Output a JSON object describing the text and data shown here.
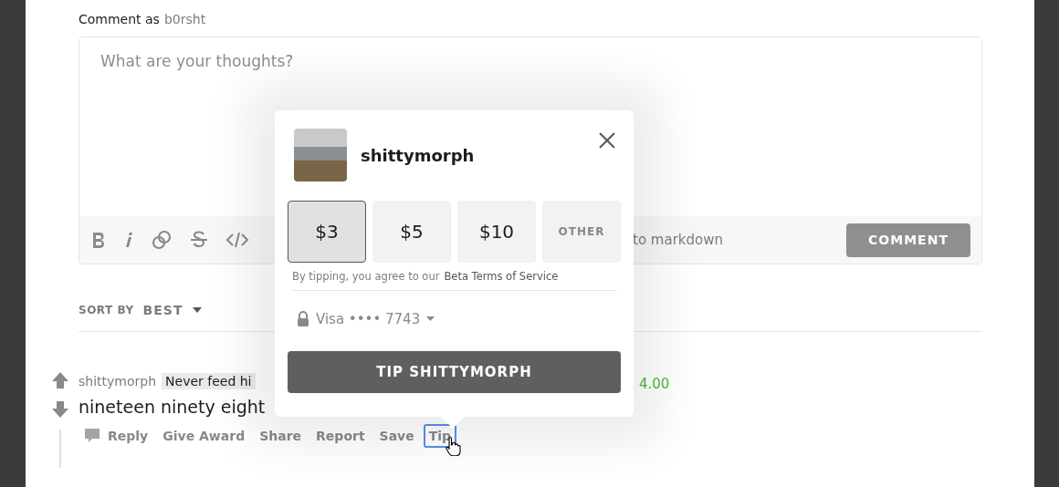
{
  "composer": {
    "label": "Comment as",
    "username": "b0rsht",
    "placeholder": "What are your thoughts?",
    "markdown_hint": "to markdown",
    "submit": {
      "label": "COMMENT",
      "disabled": true
    }
  },
  "sort": {
    "label": "SORT BY",
    "value": "BEST"
  },
  "comment": {
    "author": "shittymorph",
    "flair": "Never feed hi",
    "amount": "4.00",
    "body": "nineteen ninety eight",
    "actions": [
      {
        "label": "Reply",
        "kind": "reply",
        "focused": false
      },
      {
        "label": "Give Award",
        "kind": "plain",
        "focused": false
      },
      {
        "label": "Share",
        "kind": "plain",
        "focused": false
      },
      {
        "label": "Report",
        "kind": "plain",
        "focused": false
      },
      {
        "label": "Save",
        "kind": "plain",
        "focused": false
      },
      {
        "label": "Tip",
        "kind": "plain",
        "focused": true
      }
    ]
  },
  "tip_popup": {
    "username": "shittymorph",
    "amounts": [
      {
        "label": "$3",
        "kind": "amount",
        "selected": true
      },
      {
        "label": "$5",
        "kind": "amount",
        "selected": false
      },
      {
        "label": "$10",
        "kind": "amount",
        "selected": false
      },
      {
        "label": "OTHER",
        "kind": "other",
        "selected": false
      }
    ],
    "terms_text": "By tipping, you agree to our",
    "terms_link": "Beta Terms of Service",
    "payment": "Visa •••• 7743",
    "tip_button": "TIP SHITTYMORPH"
  }
}
